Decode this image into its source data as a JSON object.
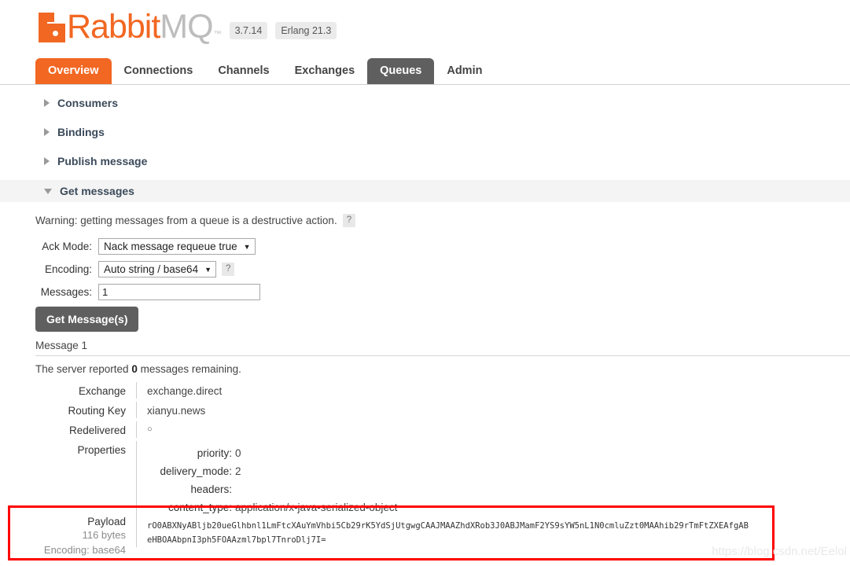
{
  "header": {
    "logo_rabbit": "Rabbit",
    "logo_mq": "MQ",
    "logo_tm": "™",
    "version": "3.7.14",
    "erlang": "Erlang 21.3"
  },
  "tabs": [
    {
      "label": "Overview",
      "state": "active"
    },
    {
      "label": "Connections",
      "state": "normal"
    },
    {
      "label": "Channels",
      "state": "normal"
    },
    {
      "label": "Exchanges",
      "state": "normal"
    },
    {
      "label": "Queues",
      "state": "selected"
    },
    {
      "label": "Admin",
      "state": "normal"
    }
  ],
  "sections": [
    {
      "label": "Consumers",
      "expanded": false
    },
    {
      "label": "Bindings",
      "expanded": false
    },
    {
      "label": "Publish message",
      "expanded": false
    },
    {
      "label": "Get messages",
      "expanded": true
    }
  ],
  "get_messages": {
    "warning": "Warning: getting messages from a queue is a destructive action.",
    "warning_help": "?",
    "ack_mode_label": "Ack Mode:",
    "ack_mode_value": "Nack message requeue true",
    "encoding_label": "Encoding:",
    "encoding_value": "Auto string / base64",
    "encoding_help": "?",
    "messages_label": "Messages:",
    "messages_value": "1",
    "messages_placeholder": "",
    "get_button": "Get Message(s)"
  },
  "result": {
    "message_heading": "Message 1",
    "server_report_prefix": "The server reported ",
    "server_report_count": "0",
    "server_report_suffix": " messages remaining.",
    "rows": [
      {
        "label": "Exchange",
        "value": "exchange.direct"
      },
      {
        "label": "Routing Key",
        "value": "xianyu.news"
      },
      {
        "label": "Redelivered",
        "value": "○"
      }
    ],
    "properties_label": "Properties",
    "properties": [
      {
        "key": "priority:",
        "value": "0"
      },
      {
        "key": "delivery_mode:",
        "value": "2"
      },
      {
        "key": "headers:",
        "value": ""
      },
      {
        "key": "content_type:",
        "value": "application/x-java-serialized-object"
      }
    ],
    "payload_label": "Payload",
    "payload_size": "116 bytes",
    "payload_encoding": "Encoding: base64",
    "payload_line1": "rO0ABXNyABljb20ueGlhbnl1LmFtcXAuYmVhbi5Cb29rK5YdSjUtgwgCAAJMAAZhdXRob3J0ABJMamF2YS9sYW5nL1N0cmluZzt0MAAhib29rTmFtZXEAfgAB",
    "payload_line2": "eHBOAAbpnI3ph5FOAAzml7bpl7TnroDlj7I="
  },
  "watermark": "https://blog.csdn.net/Eelol"
}
